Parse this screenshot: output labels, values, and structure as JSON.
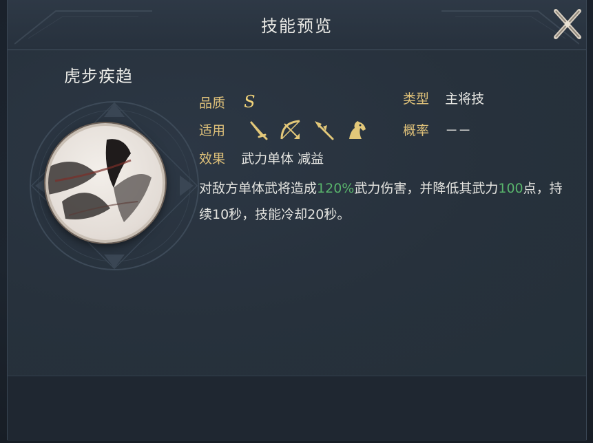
{
  "dialog": {
    "title": "技能预览",
    "close_icon": "close-x-icon"
  },
  "skill": {
    "name": "虎步疾趋",
    "quality_label": "品质",
    "quality_value": "S",
    "type_label": "类型",
    "type_value": "主将技",
    "applicable_label": "适用",
    "applicable_icons": [
      "sword-icon",
      "bow-icon",
      "spear-icon",
      "horse-icon"
    ],
    "rate_label": "概率",
    "rate_value": "－－",
    "effect_label": "效果",
    "effect_value": "武力单体 减益",
    "description": {
      "part1": "对敌方单体武将造成",
      "hl1": "120%",
      "part2": "武力伤害，并降低其武力",
      "hl2": "100",
      "part3": "点，持续10秒，技能冷却20秒。"
    }
  },
  "colors": {
    "label": "#e0c27a",
    "highlight": "#59b56c",
    "text": "#e6e6e2",
    "panel": "#27313d"
  }
}
